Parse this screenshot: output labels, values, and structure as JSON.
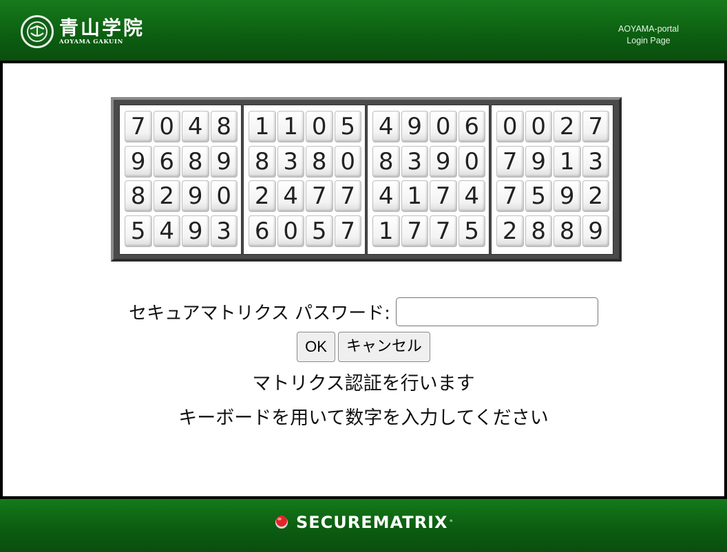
{
  "header": {
    "logo_kanji": "青山学院",
    "logo_roman": "AOYAMA GAKUIN",
    "portal_line1": "AOYAMA-portal",
    "portal_line2": "Login Page"
  },
  "matrix": {
    "blocks": [
      [
        [
          "7",
          "0",
          "4",
          "8"
        ],
        [
          "9",
          "6",
          "8",
          "9"
        ],
        [
          "8",
          "2",
          "9",
          "0"
        ],
        [
          "5",
          "4",
          "9",
          "3"
        ]
      ],
      [
        [
          "1",
          "1",
          "0",
          "5"
        ],
        [
          "8",
          "3",
          "8",
          "0"
        ],
        [
          "2",
          "4",
          "7",
          "7"
        ],
        [
          "6",
          "0",
          "5",
          "7"
        ]
      ],
      [
        [
          "4",
          "9",
          "0",
          "6"
        ],
        [
          "8",
          "3",
          "9",
          "0"
        ],
        [
          "4",
          "1",
          "7",
          "4"
        ],
        [
          "1",
          "7",
          "7",
          "5"
        ]
      ],
      [
        [
          "0",
          "0",
          "2",
          "7"
        ],
        [
          "7",
          "9",
          "1",
          "3"
        ],
        [
          "7",
          "5",
          "9",
          "2"
        ],
        [
          "2",
          "8",
          "8",
          "9"
        ]
      ]
    ]
  },
  "form": {
    "password_label": "セキュアマトリクス パスワード:",
    "password_value": "",
    "ok_label": "OK",
    "cancel_label": "キャンセル"
  },
  "messages": {
    "line1": "マトリクス認証を行います",
    "line2": "キーボードを用いて数字を入力してください"
  },
  "footer": {
    "brand": "SECUREMATRIX",
    "reg_mark": "°",
    "icon": "securematrix-logo-icon"
  },
  "colors": {
    "header_green": "#0c5e11",
    "footer_green": "#0c5d11"
  }
}
